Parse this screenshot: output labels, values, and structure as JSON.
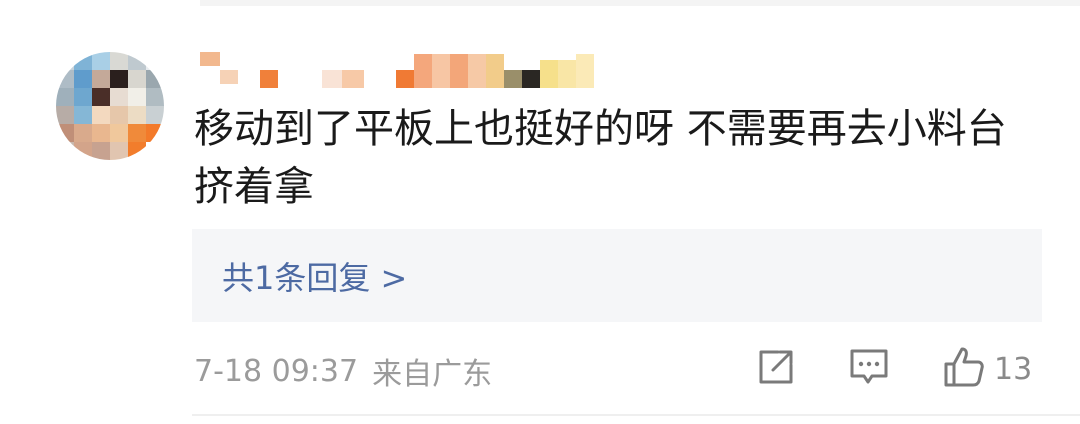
{
  "comment": {
    "text": "移动到了平板上也挺好的呀 不需要再去小料台挤着拿",
    "replies_label": "共1条回复 >",
    "date": "7-18 09:37",
    "location": "来自广东",
    "like_count": "13"
  },
  "icons": {
    "share": "share-icon",
    "comment": "comment-icon",
    "like": "thumbs-up-icon"
  },
  "colors": {
    "link": "#4d6aa3",
    "meta": "#9b9b9b",
    "reply_bg": "#f5f6f8",
    "text": "#1a1a1a"
  }
}
